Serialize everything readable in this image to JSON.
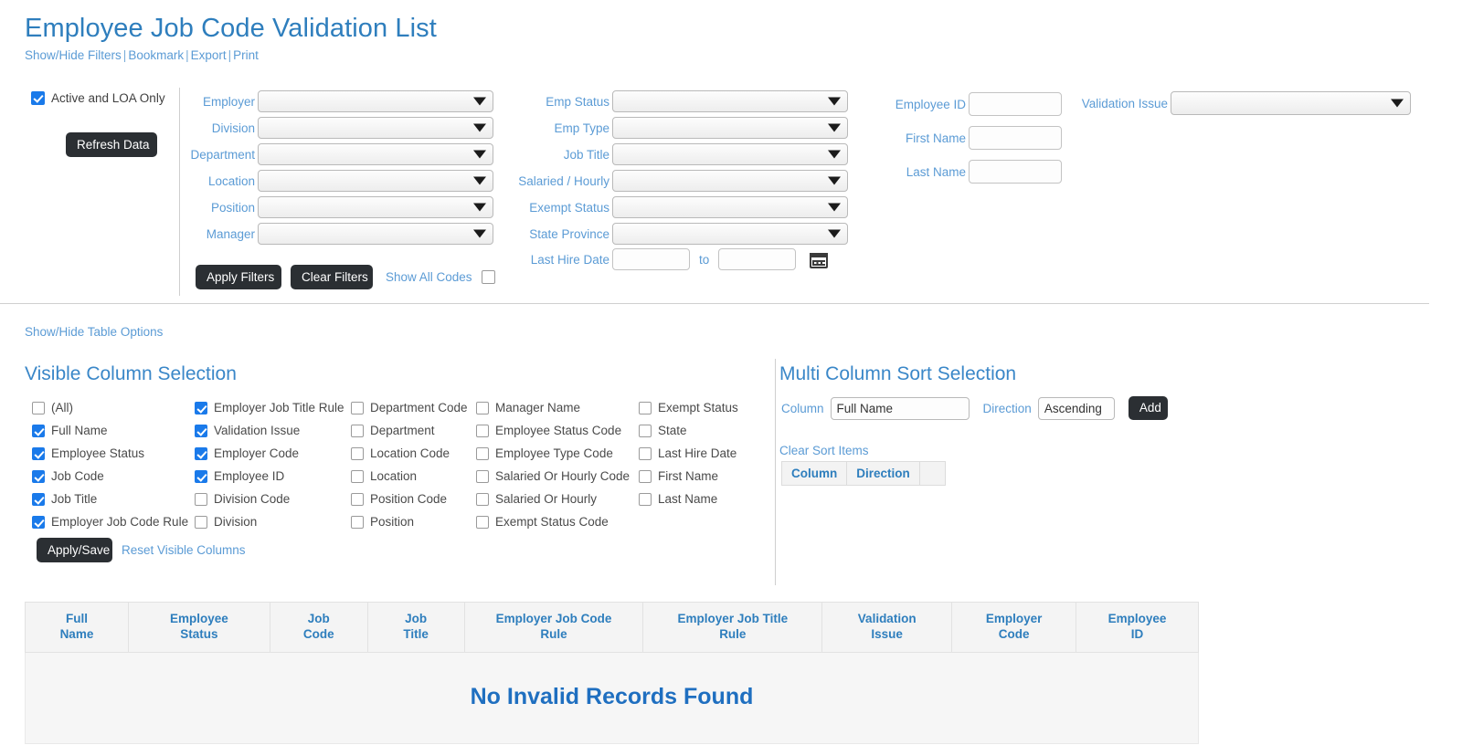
{
  "header": {
    "title": "Employee Job Code Validation List",
    "links": [
      "Show/Hide Filters",
      "Bookmark",
      "Export",
      "Print"
    ],
    "separator": "|"
  },
  "filters": {
    "active_loa_checkbox": {
      "label": "Active and LOA Only",
      "checked": true
    },
    "refresh_button": "Refresh Data",
    "column1": [
      {
        "label": "Employer",
        "value": ""
      },
      {
        "label": "Division",
        "value": ""
      },
      {
        "label": "Department",
        "value": ""
      },
      {
        "label": "Location",
        "value": ""
      },
      {
        "label": "Position",
        "value": ""
      },
      {
        "label": "Manager",
        "value": ""
      }
    ],
    "column2": [
      {
        "label": "Emp Status",
        "value": ""
      },
      {
        "label": "Emp Type",
        "value": ""
      },
      {
        "label": "Job Title",
        "value": ""
      },
      {
        "label": "Salaried / Hourly",
        "value": ""
      },
      {
        "label": "Exempt Status",
        "value": ""
      },
      {
        "label": "State Province",
        "value": ""
      }
    ],
    "last_hire_date": {
      "label": "Last Hire Date",
      "from_value": "",
      "to_label": "to",
      "to_value": "",
      "calendar_icon": "calendar-icon"
    },
    "column3": [
      {
        "label": "Employee ID",
        "value": ""
      },
      {
        "label": "First Name",
        "value": ""
      },
      {
        "label": "Last Name",
        "value": ""
      }
    ],
    "validation_issue": {
      "label": "Validation Issue",
      "value": ""
    },
    "apply_button": "Apply Filters",
    "clear_button": "Clear Filters",
    "show_all_codes": {
      "label": "Show All Codes",
      "checked": false
    }
  },
  "table_options": {
    "toggle_link": "Show/Hide Table Options",
    "visible_columns": {
      "title": "Visible Column Selection",
      "columns": [
        [
          {
            "label": "(All)",
            "checked": false
          },
          {
            "label": "Full Name",
            "checked": true
          },
          {
            "label": "Employee Status",
            "checked": true
          },
          {
            "label": "Job Code",
            "checked": true
          },
          {
            "label": "Job Title",
            "checked": true
          },
          {
            "label": "Employer Job Code Rule",
            "checked": true
          }
        ],
        [
          {
            "label": "Employer Job Title Rule",
            "checked": true
          },
          {
            "label": "Validation Issue",
            "checked": true
          },
          {
            "label": "Employer Code",
            "checked": true
          },
          {
            "label": "Employee ID",
            "checked": true
          },
          {
            "label": "Division Code",
            "checked": false
          },
          {
            "label": "Division",
            "checked": false
          }
        ],
        [
          {
            "label": "Department Code",
            "checked": false
          },
          {
            "label": "Department",
            "checked": false
          },
          {
            "label": "Location Code",
            "checked": false
          },
          {
            "label": "Location",
            "checked": false
          },
          {
            "label": "Position Code",
            "checked": false
          },
          {
            "label": "Position",
            "checked": false
          }
        ],
        [
          {
            "label": "Manager Name",
            "checked": false
          },
          {
            "label": "Employee Status Code",
            "checked": false
          },
          {
            "label": "Employee Type Code",
            "checked": false
          },
          {
            "label": "Salaried Or Hourly Code",
            "checked": false
          },
          {
            "label": "Salaried Or Hourly",
            "checked": false
          },
          {
            "label": "Exempt Status Code",
            "checked": false
          }
        ],
        [
          {
            "label": "Exempt Status",
            "checked": false
          },
          {
            "label": "State",
            "checked": false
          },
          {
            "label": "Last Hire Date",
            "checked": false
          },
          {
            "label": "First Name",
            "checked": false
          },
          {
            "label": "Last Name",
            "checked": false
          }
        ]
      ],
      "apply_save_button": "Apply/Save",
      "reset_link": "Reset Visible Columns"
    },
    "multi_sort": {
      "title": "Multi Column Sort Selection",
      "column_label": "Column",
      "column_value": "Full Name",
      "direction_label": "Direction",
      "direction_value": "Ascending",
      "add_button": "Add",
      "clear_link": "Clear Sort Items",
      "table_headers": [
        "Column",
        "Direction",
        ""
      ]
    }
  },
  "results_table": {
    "headers": [
      {
        "line1": "Full",
        "line2": "Name"
      },
      {
        "line1": "Employee",
        "line2": "Status"
      },
      {
        "line1": "Job",
        "line2": "Code"
      },
      {
        "line1": "Job",
        "line2": "Title"
      },
      {
        "line1": "Employer Job Code",
        "line2": "Rule"
      },
      {
        "line1": "Employer Job Title",
        "line2": "Rule"
      },
      {
        "line1": "Validation",
        "line2": "Issue"
      },
      {
        "line1": "Employer",
        "line2": "Code"
      },
      {
        "line1": "Employee",
        "line2": "ID"
      }
    ],
    "empty_message": "No Invalid Records Found"
  },
  "colors": {
    "title_blue": "#2e7ebd",
    "link_blue": "#5b9bd5",
    "checkbox_blue": "#1a7aea",
    "button_dark": "#2b2f33",
    "header_blue": "#2e7ebd"
  }
}
